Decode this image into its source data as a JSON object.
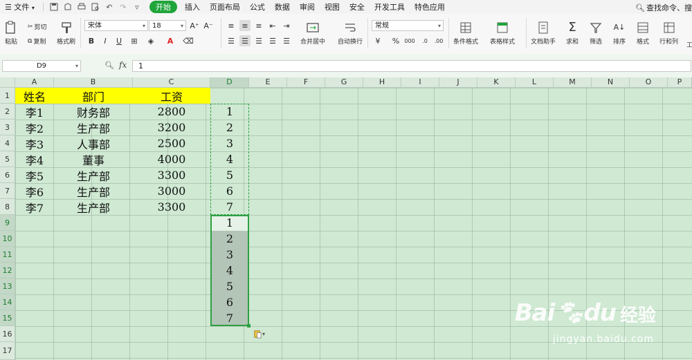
{
  "menu": {
    "file": "文件",
    "items": [
      "开始",
      "插入",
      "页面布局",
      "公式",
      "数据",
      "审阅",
      "视图",
      "安全",
      "开发工具",
      "特色应用"
    ],
    "active_index": 0,
    "search": "查找命令、搜"
  },
  "ribbon": {
    "paste": "粘贴",
    "cut": "剪切",
    "copy": "复制",
    "format_painter": "格式刷",
    "font_name": "宋体",
    "font_size": "18",
    "bold": "B",
    "italic": "I",
    "underline": "U",
    "font_color_glyph": "A",
    "merge_center": "合并居中",
    "wrap_text": "自动换行",
    "number_format": "常规",
    "percent": "%",
    "cond_format": "条件格式",
    "table_style": "表格样式",
    "doc_helper": "文档助手",
    "sum": "求和",
    "filter": "筛选",
    "sort": "排序",
    "format": "格式",
    "row_col": "行和列",
    "work": "工"
  },
  "formula_bar": {
    "name_box": "D9",
    "fx": "fx",
    "content": "1"
  },
  "columns": [
    "A",
    "B",
    "C",
    "D",
    "E",
    "F",
    "G",
    "H",
    "I",
    "J",
    "K",
    "L",
    "M",
    "N",
    "O",
    "P"
  ],
  "rows": [
    "1",
    "2",
    "3",
    "4",
    "5",
    "6",
    "7",
    "8",
    "9",
    "10",
    "11",
    "12",
    "13",
    "14",
    "15",
    "16",
    "17"
  ],
  "table": {
    "headers": [
      "姓名",
      "部门",
      "工资"
    ],
    "rows": [
      [
        "李1",
        "财务部",
        "2800"
      ],
      [
        "李2",
        "生产部",
        "3200"
      ],
      [
        "李3",
        "人事部",
        "2500"
      ],
      [
        "李4",
        "董事",
        "4000"
      ],
      [
        "李5",
        "生产部",
        "3300"
      ],
      [
        "李6",
        "生产部",
        "3000"
      ],
      [
        "李7",
        "生产部",
        "3300"
      ]
    ]
  },
  "column_d": {
    "copied": [
      "1",
      "2",
      "3",
      "4",
      "5",
      "6",
      "7"
    ],
    "pasted": [
      "1",
      "2",
      "3",
      "4",
      "5",
      "6",
      "7"
    ]
  },
  "watermark": {
    "brand": "Bai",
    "brand2": "du",
    "cn": "经验",
    "url": "jingyan.baidu.com"
  },
  "colors": {
    "sheet_bg": "#cfe9d3",
    "header_fill": "#ffff00",
    "selection": "#2ea043",
    "active_tab": "#1fa53a"
  }
}
